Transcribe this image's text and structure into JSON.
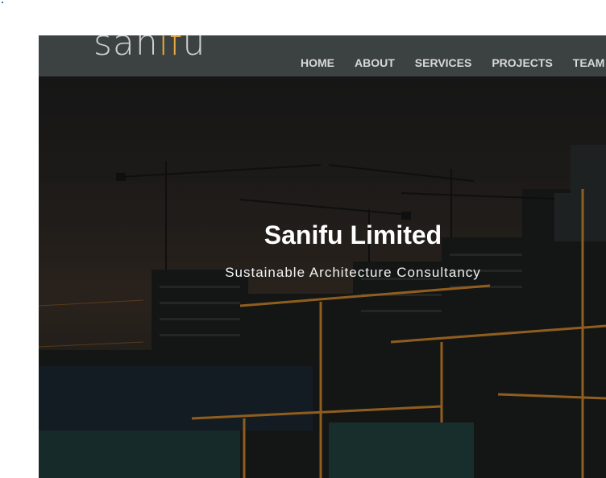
{
  "brand": {
    "logo_part1": "san",
    "logo_part2": "if",
    "logo_part3": "u",
    "accent_color": "#e8a940"
  },
  "nav": {
    "items": [
      {
        "label": "HOME"
      },
      {
        "label": "ABOUT"
      },
      {
        "label": "SERVICES"
      },
      {
        "label": "PROJECTS"
      },
      {
        "label": "TEAM"
      }
    ]
  },
  "hero": {
    "title": "Sanifu Limited",
    "subtitle": "Sustainable Architecture Consultancy"
  }
}
